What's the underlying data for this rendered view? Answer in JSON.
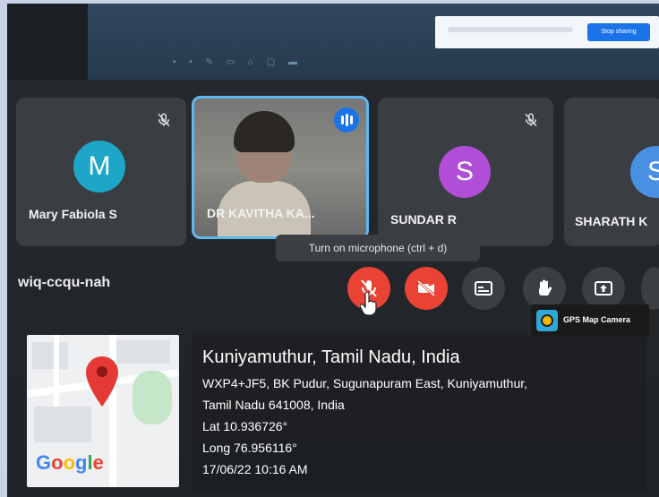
{
  "share_bar": {
    "button_label": "Stop sharing"
  },
  "participants": [
    {
      "name": "Mary Fabiola S",
      "initial": "M",
      "avatar_color": "#1ea6c8",
      "muted": true
    },
    {
      "name": "DR KAVITHA KA...",
      "initial": "",
      "avatar_color": "",
      "muted": false,
      "speaking": true
    },
    {
      "name": "SUNDAR R",
      "initial": "S",
      "avatar_color": "#b04ed8",
      "muted": true
    },
    {
      "name": "SHARATH K",
      "initial": "S",
      "avatar_color": "#4a90e2",
      "muted": false
    }
  ],
  "tooltip": "Turn on microphone (ctrl + d)",
  "meeting_code": "wiq-ccqu-nah",
  "controls": [
    {
      "id": "mic",
      "icon": "mic-off-icon",
      "color": "#ea4335"
    },
    {
      "id": "camera",
      "icon": "camera-off-icon",
      "color": "#ea4335"
    },
    {
      "id": "captions",
      "icon": "captions-icon",
      "color": "#3b3e43"
    },
    {
      "id": "raise-hand",
      "icon": "hand-icon",
      "color": "#3b3e43"
    },
    {
      "id": "present",
      "icon": "present-screen-icon",
      "color": "#3b3e43"
    }
  ],
  "gps_badge": "GPS Map Camera",
  "location": {
    "title": "Kuniyamuthur, Tamil Nadu, India",
    "address_line1": "WXP4+JF5, BK Pudur, Sugunapuram East, Kuniyamuthur,",
    "address_line2": "Tamil Nadu 641008, India",
    "lat": "Lat 10.936726°",
    "long": "Long 76.956116°",
    "datetime": "17/06/22 10:16 AM"
  },
  "map_logo": "Google"
}
